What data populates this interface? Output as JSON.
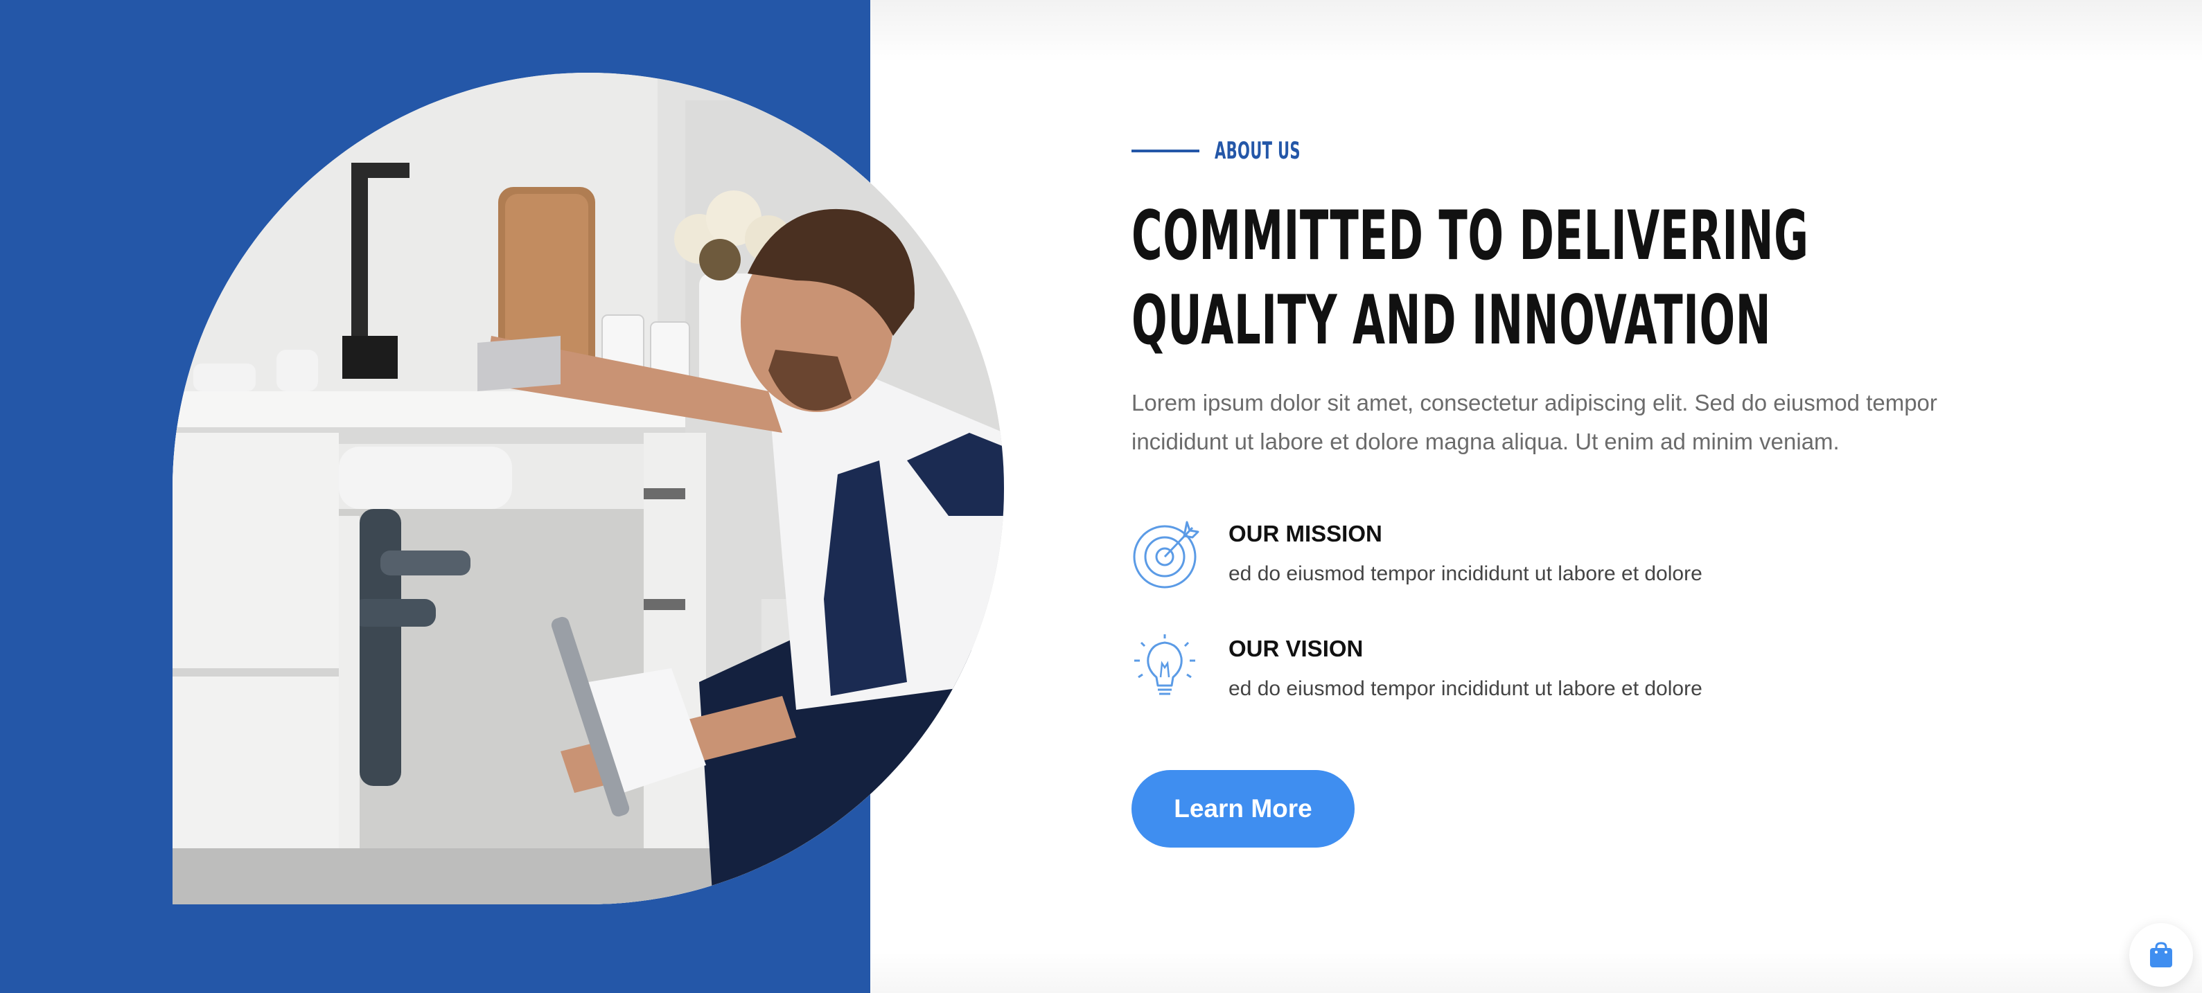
{
  "about": {
    "eyebrow": "ABOUT US",
    "headline": "COMMITTED TO DELIVERING QUALITY AND INNOVATION",
    "intro": "Lorem ipsum dolor sit amet, consectetur adipiscing elit. Sed do eiusmod tempor incididunt ut labore et dolore magna aliqua. Ut enim ad minim veniam.",
    "image_subject": "plumber fixing kitchen sink pipes",
    "features": [
      {
        "icon": "target-icon",
        "title": "OUR MISSION",
        "description": "ed do eiusmod tempor incididunt ut labore et dolore"
      },
      {
        "icon": "lightbulb-icon",
        "title": "OUR VISION",
        "description": "ed do eiusmod tempor incididunt ut labore et dolore"
      }
    ],
    "cta_label": "Learn More"
  },
  "floating": {
    "icon": "shopping-bag-icon"
  },
  "colors": {
    "brand_blue": "#2457a8",
    "button_blue": "#3f8ef0",
    "heading": "#111111",
    "body_text": "#6b6b6b",
    "icon_blue": "#5b9be6"
  }
}
